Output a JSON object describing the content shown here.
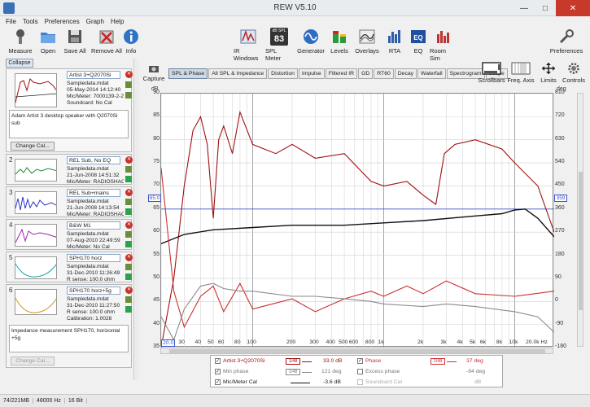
{
  "window": {
    "title": "REW V5.10",
    "controls": [
      "—",
      "□",
      "✕"
    ]
  },
  "menu": [
    "File",
    "Tools",
    "Preferences",
    "Graph",
    "Help"
  ],
  "toolbar_left": [
    {
      "label": "Measure",
      "icon": "measure-icon"
    },
    {
      "label": "Open",
      "icon": "open-folder-icon"
    },
    {
      "label": "Save All",
      "icon": "save-icon"
    },
    {
      "label": "Remove All",
      "icon": "remove-all-icon"
    },
    {
      "label": "Info",
      "icon": "info-icon"
    }
  ],
  "toolbar_right": [
    {
      "label": "IR Windows",
      "icon": "ir-windows-icon"
    },
    {
      "label": "SPL Meter",
      "icon": "spl-meter-icon"
    },
    {
      "label": "Generator",
      "icon": "generator-icon"
    },
    {
      "label": "Levels",
      "icon": "levels-icon"
    },
    {
      "label": "Overlays",
      "icon": "overlays-icon"
    },
    {
      "label": "RTA",
      "icon": "rta-icon"
    },
    {
      "label": "EQ",
      "icon": "eq-icon"
    },
    {
      "label": "Room Sim",
      "icon": "room-sim-icon"
    }
  ],
  "spl_meter_badge": {
    "unit": "dB SPL",
    "value": "83"
  },
  "preferences_label": "Preferences",
  "collapse_label": "Collapse",
  "measurements": [
    {
      "name": "Artist 3+Q2070Si",
      "file": "Sampledata.mdat",
      "date": "05-May-2014 14:12:40",
      "mic": "Mic/Meter: 7000139-2-21",
      "sound": "Soundcard: No Cal",
      "notes": "Adam Artist 3 desktop speaker with Q2070Si sub",
      "button": "Change Cal...",
      "num": "1"
    },
    {
      "name": "REL Sub, No EQ",
      "file": "Sampledata.mdat",
      "date": "21-Jun-2008 14:51:32",
      "mic": "Mic/Meter: RADIOSHACK",
      "num": "2"
    },
    {
      "name": "REL Sub+mains",
      "file": "Sampledata.mdat",
      "date": "21-Jun-2008 14:13:54",
      "mic": "Mic/Meter: RADIOSHACK",
      "num": "3"
    },
    {
      "name": "B&W M1",
      "file": "Sampledata.mdat",
      "date": "07-Aug-2010 22:49:59",
      "mic": "Mic/Meter: No Cal",
      "num": "4"
    },
    {
      "name": "SPH170 horz",
      "file": "Sampledata.mdat",
      "date": "31-Dec-2010 11:26:49",
      "mic": "R sense: 100.0 ohm",
      "num": "5"
    },
    {
      "name": "SPH170 horz+5g",
      "file": "Sampledata.mdat",
      "date": "31-Dec-2010 11:27:50",
      "mic": "R sense: 100.0 ohm",
      "extra": "Calibration: 1.0028",
      "notes": "Impedance measurement SPH170, horizontal +5g",
      "button": "Change Cal...",
      "num": "6"
    }
  ],
  "capture_label": "Capture",
  "tabs": [
    "SPL & Phase",
    "All SPL & Impedance",
    "Distortion",
    "Impulse",
    "Filtered IR",
    "GD",
    "RT60",
    "Decay",
    "Waterfall",
    "Spectrogram",
    "Scope"
  ],
  "active_tab": "SPL & Phase",
  "graph_tools": [
    {
      "label": "Scrollbars",
      "icon": "scrollbars-icon"
    },
    {
      "label": "Freq. Axis",
      "icon": "freq-axis-icon"
    },
    {
      "label": "Limits",
      "icon": "limits-icon"
    },
    {
      "label": "Controls",
      "icon": "controls-icon"
    }
  ],
  "axis": {
    "left_unit": "dB",
    "right_unit": "deg",
    "y_ticks": [
      "90",
      "85",
      "80",
      "75",
      "70",
      "65",
      "60",
      "55",
      "50",
      "45",
      "40",
      "35"
    ],
    "y2_ticks": [
      "810",
      "720",
      "630",
      "540",
      "450",
      "360",
      "270",
      "180",
      "90",
      "0",
      "-90",
      "-180"
    ],
    "x_ticks": [
      "20.0",
      "30",
      "40",
      "50",
      "60",
      "80",
      "100",
      "200",
      "300",
      "400",
      "500",
      "600",
      "800",
      "1k",
      "2k",
      "3k",
      "4k",
      "5k",
      "6k",
      "8k",
      "10k",
      "20.0k Hz"
    ],
    "left_marker": "65.0",
    "right_marker": "359"
  },
  "chart_data": {
    "type": "line",
    "xlabel": "Hz",
    "ylabel": "dB",
    "xscale": "log",
    "xlim": [
      20,
      20000
    ],
    "ylim": [
      35,
      90
    ],
    "series": [
      {
        "name": "Artist 3+Q2070Si",
        "color": "#a01010",
        "x": [
          20,
          25,
          30,
          35,
          40,
          45,
          50,
          55,
          60,
          70,
          80,
          100,
          150,
          200,
          300,
          500,
          800,
          1000,
          1500,
          2000,
          2500,
          2900,
          3500,
          5000,
          8000,
          10000,
          15000,
          20000
        ],
        "y": [
          35,
          50,
          70,
          82,
          85,
          79,
          63,
          80,
          83,
          77,
          86,
          79,
          77,
          79,
          76,
          77,
          71,
          70,
          71,
          68,
          66,
          77,
          79,
          80,
          78,
          75,
          70,
          60
        ]
      },
      {
        "name": "Mic/Meter Cal",
        "color": "#111111",
        "x": [
          20,
          30,
          50,
          100,
          200,
          500,
          1000,
          2000,
          5000,
          8000,
          10000,
          12000,
          15000,
          20000
        ],
        "y": [
          57.5,
          59.5,
          60.5,
          61,
          61.5,
          61.5,
          62,
          62.5,
          63.5,
          64,
          64.8,
          65,
          63,
          59
        ]
      },
      {
        "name": "Phase",
        "color": "#cc3030",
        "x": [
          20,
          25,
          30,
          40,
          50,
          60,
          80,
          100,
          200,
          300,
          500,
          800,
          1000,
          1500,
          2000,
          3000,
          5000,
          10000,
          20000
        ],
        "y": [
          520,
          40,
          -100,
          20,
          60,
          -40,
          70,
          -30,
          10,
          -40,
          10,
          40,
          20,
          60,
          30,
          80,
          30,
          20,
          40
        ]
      },
      {
        "name": "Min phase",
        "color": "#8a8a8a",
        "x": [
          20,
          25,
          30,
          40,
          50,
          60,
          80,
          100,
          200,
          300,
          500,
          800,
          1000,
          2000,
          3000,
          5000,
          10000,
          15000,
          20000
        ],
        "y": [
          -60,
          -150,
          -30,
          60,
          70,
          50,
          40,
          40,
          20,
          20,
          10,
          0,
          -10,
          -20,
          -10,
          -20,
          -40,
          -60,
          -120
        ]
      }
    ]
  },
  "legend": [
    {
      "label": "Artist 3+Q2070Si",
      "value": "33.0 dB",
      "checked": true,
      "color": "#a01010",
      "badge": "1/48"
    },
    {
      "label": "Min phase",
      "value": "121 deg",
      "checked": true,
      "color": "#8a8a8a",
      "badge": "1/48"
    },
    {
      "label": "Mic/Meter Cal",
      "value": "-3.6 dB",
      "checked": true,
      "color": "#111111",
      "badge": ""
    },
    {
      "label": "Phase",
      "value": "37 deg",
      "checked": true,
      "color": "#cc3030",
      "badge": "1/48"
    },
    {
      "label": "Excess phase",
      "value": "-94 deg",
      "checked": false,
      "color": "#999999",
      "badge": ""
    },
    {
      "label": "Soundcard Cal",
      "value": "dB",
      "checked": false,
      "color": "#bbbbbb",
      "badge": ""
    }
  ],
  "status": [
    "74/221MB",
    "48000 Hz",
    "16 Bit"
  ]
}
